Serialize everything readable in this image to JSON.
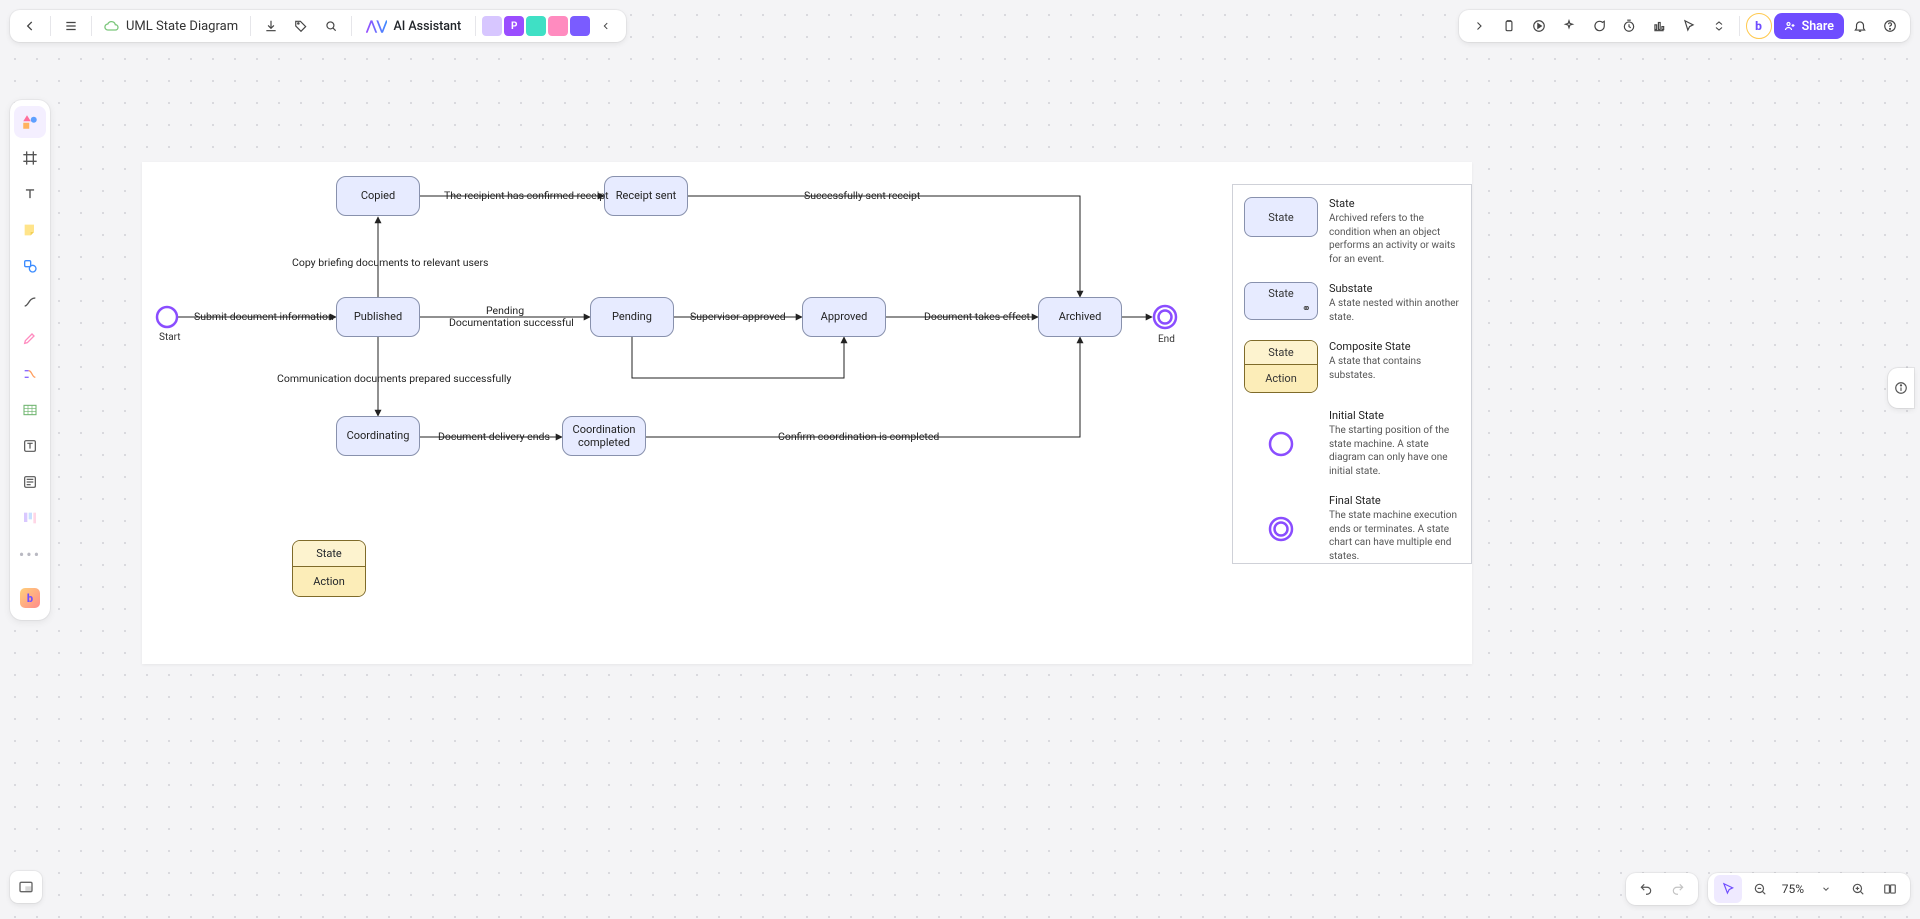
{
  "header": {
    "title": "UML State Diagram",
    "ai_label": "AI Assistant",
    "share_label": "Share"
  },
  "collab": [
    {
      "letter": "",
      "bg": "#d7c6ff"
    },
    {
      "letter": "P",
      "bg": "#9a4dff"
    },
    {
      "letter": "",
      "bg": "#3fe0c5"
    },
    {
      "letter": "",
      "bg": "#ff8bbf"
    },
    {
      "letter": "",
      "bg": "#7a5cff"
    }
  ],
  "footer": {
    "zoom": "75%"
  },
  "nodes": {
    "start_label": "Start",
    "end_label": "End",
    "copied": "Copied",
    "receipt_sent": "Receipt sent",
    "published": "Published",
    "pending": "Pending",
    "approved": "Approved",
    "archived": "Archived",
    "coordinating": "Coordinating",
    "coord_done": "Coordination completed"
  },
  "edges": {
    "e1": "Submit document information",
    "e2": "Copy briefing documents to relevant users",
    "e3": "The recipient has confirmed receipt",
    "e4": "Successfully sent receipt",
    "e5a": "Pending",
    "e5b": "Documentation successful",
    "e6": "Supervisor approved",
    "e7": "Document takes effect",
    "e8": "Communication documents prepared successfully",
    "e9": "Document delivery ends",
    "e10": "Confirm coordination is completed"
  },
  "composite": {
    "state": "State",
    "action": "Action"
  },
  "legend": {
    "state": {
      "label": "State",
      "title": "State",
      "desc": "Archived refers to the condition when an object performs an activity or waits for an event."
    },
    "substate": {
      "label": "State",
      "title": "Substate",
      "desc": "A state nested within another state."
    },
    "composite": {
      "label_top": "State",
      "label_bot": "Action",
      "title": "Composite State",
      "desc": "A state that contains substates."
    },
    "initial": {
      "title": "Initial State",
      "desc": "The starting position of the state machine. A state diagram can only have one initial state."
    },
    "final": {
      "title": "Final State",
      "desc": "The state machine execution ends or terminates. A state chart can have multiple end states."
    }
  },
  "chart_data": {
    "type": "diagram",
    "diagram_type": "uml-state",
    "nodes": [
      {
        "id": "start",
        "kind": "initial",
        "label": "Start"
      },
      {
        "id": "published",
        "kind": "state",
        "label": "Published"
      },
      {
        "id": "copied",
        "kind": "state",
        "label": "Copied"
      },
      {
        "id": "receipt",
        "kind": "state",
        "label": "Receipt sent"
      },
      {
        "id": "pending",
        "kind": "state",
        "label": "Pending"
      },
      {
        "id": "approved",
        "kind": "state",
        "label": "Approved"
      },
      {
        "id": "archived",
        "kind": "state",
        "label": "Archived"
      },
      {
        "id": "coordinating",
        "kind": "state",
        "label": "Coordinating"
      },
      {
        "id": "coord_done",
        "kind": "state",
        "label": "Coordination completed"
      },
      {
        "id": "end",
        "kind": "final",
        "label": "End"
      }
    ],
    "edges": [
      {
        "from": "start",
        "to": "published",
        "label": "Submit document information"
      },
      {
        "from": "published",
        "to": "copied",
        "label": "Copy briefing documents to relevant users"
      },
      {
        "from": "copied",
        "to": "receipt",
        "label": "The recipient has confirmed receipt"
      },
      {
        "from": "receipt",
        "to": "archived",
        "label": "Successfully sent receipt"
      },
      {
        "from": "published",
        "to": "pending",
        "label": "Pending Documentation successful"
      },
      {
        "from": "pending",
        "to": "approved",
        "label": "Supervisor approved"
      },
      {
        "from": "approved",
        "to": "archived",
        "label": "Document takes effect"
      },
      {
        "from": "published",
        "to": "coordinating",
        "label": "Communication documents prepared successfully"
      },
      {
        "from": "coordinating",
        "to": "coord_done",
        "label": "Document delivery ends"
      },
      {
        "from": "coord_done",
        "to": "archived",
        "label": "Confirm coordination is completed"
      },
      {
        "from": "pending",
        "to": "approved",
        "label": "",
        "note": "secondary route via lower elbow"
      },
      {
        "from": "archived",
        "to": "end",
        "label": ""
      }
    ]
  }
}
